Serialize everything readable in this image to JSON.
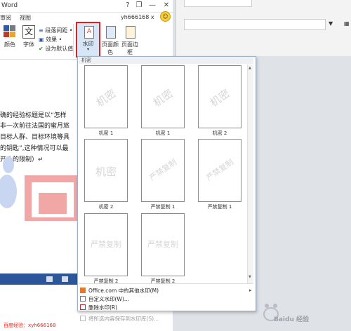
{
  "window": {
    "title": "Word",
    "help_glyph": "?",
    "minimize_glyph": "—",
    "close_glyph": "✕",
    "maximize_glyph": "❐"
  },
  "menubar": {
    "items": [
      "审阅",
      "视图"
    ]
  },
  "user": {
    "name": "yh666168 x"
  },
  "ribbon": {
    "colors_label": "颜色",
    "font_label": "字体",
    "font_glyph": "文",
    "paragraph_spacing": "段落间距 •",
    "effects": "效果 •",
    "set_default": "设为默认值",
    "watermark_label": "水印",
    "page_color_label": "页面颜色",
    "page_border_label": "页面边框"
  },
  "document": {
    "lines": [
      "确的经验标题是以“怎样",
      "目标人群、目标环境等具",
      "的钥匙”,这种情况可以最",
      "开头的限制）↵"
    ],
    "line2_prefix": "非一次前往法国的蜜月旅"
  },
  "gallery": {
    "header": "机密",
    "items": [
      {
        "label": "机密 1",
        "text": "机密",
        "style": "diagonal"
      },
      {
        "label": "机密 1",
        "text": "机密",
        "style": "diagonal"
      },
      {
        "label": "机密 2",
        "text": "机密",
        "style": "diagonal"
      },
      {
        "label": "机密 2",
        "text": "机密",
        "style": "horizontal"
      },
      {
        "label": "严禁复制 1",
        "text": "严禁复制",
        "style": "diagonal"
      },
      {
        "label": "严禁复制 1",
        "text": "严禁复制",
        "style": "diagonal"
      },
      {
        "label": "严禁复制 2",
        "text": "严禁复制",
        "style": "horizontal"
      },
      {
        "label": "严禁复制 2",
        "text": "严禁复制",
        "style": "horizontal"
      }
    ]
  },
  "menu": {
    "more_watermarks": "Office.com 中的其他水印(M)",
    "custom_watermark": "自定义水印(W)...",
    "remove_watermark": "删除水印(R)",
    "save_to_gallery": "将所选内容保存到水印库(S)..."
  },
  "footer": {
    "text": "百度经验：xyh666168"
  },
  "brand": {
    "text": "Baidu 经验",
    "url_hint": "jingyan.baidu.com"
  }
}
